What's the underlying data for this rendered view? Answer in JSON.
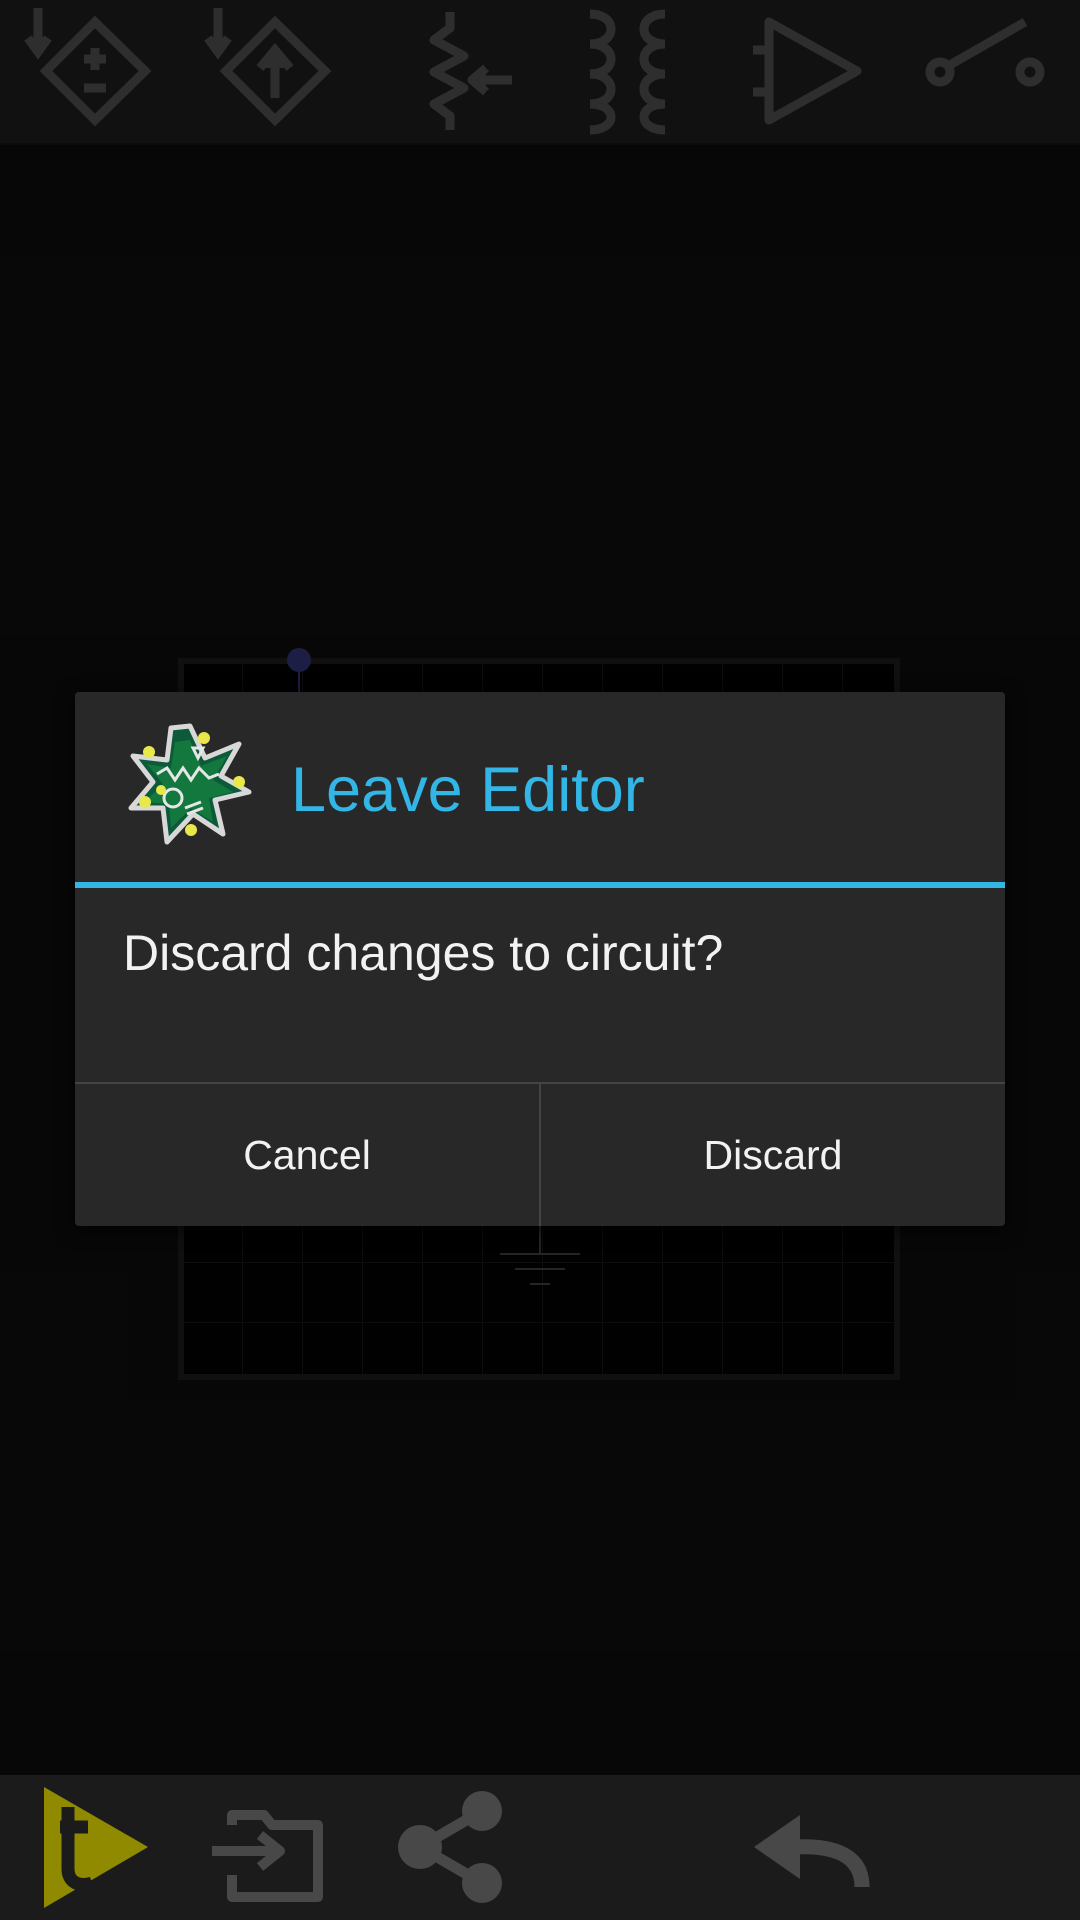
{
  "toolbar": {
    "tools": [
      {
        "name": "dependent-voltage-source-icon"
      },
      {
        "name": "dependent-current-source-icon"
      },
      {
        "name": "variable-resistor-icon"
      },
      {
        "name": "transformer-icon"
      },
      {
        "name": "op-amp-icon"
      },
      {
        "name": "switch-icon"
      }
    ],
    "icon_color": "#484848"
  },
  "dialog": {
    "title": "Leave Editor",
    "message": "Discard changes to circuit?",
    "cancel_label": "Cancel",
    "discard_label": "Discard",
    "accent_color": "#33b5e5"
  },
  "bottom_bar": {
    "icons": [
      "run-transient-icon",
      "import-icon",
      "share-icon",
      "undo-icon"
    ],
    "run_color": "#8f8a00"
  }
}
